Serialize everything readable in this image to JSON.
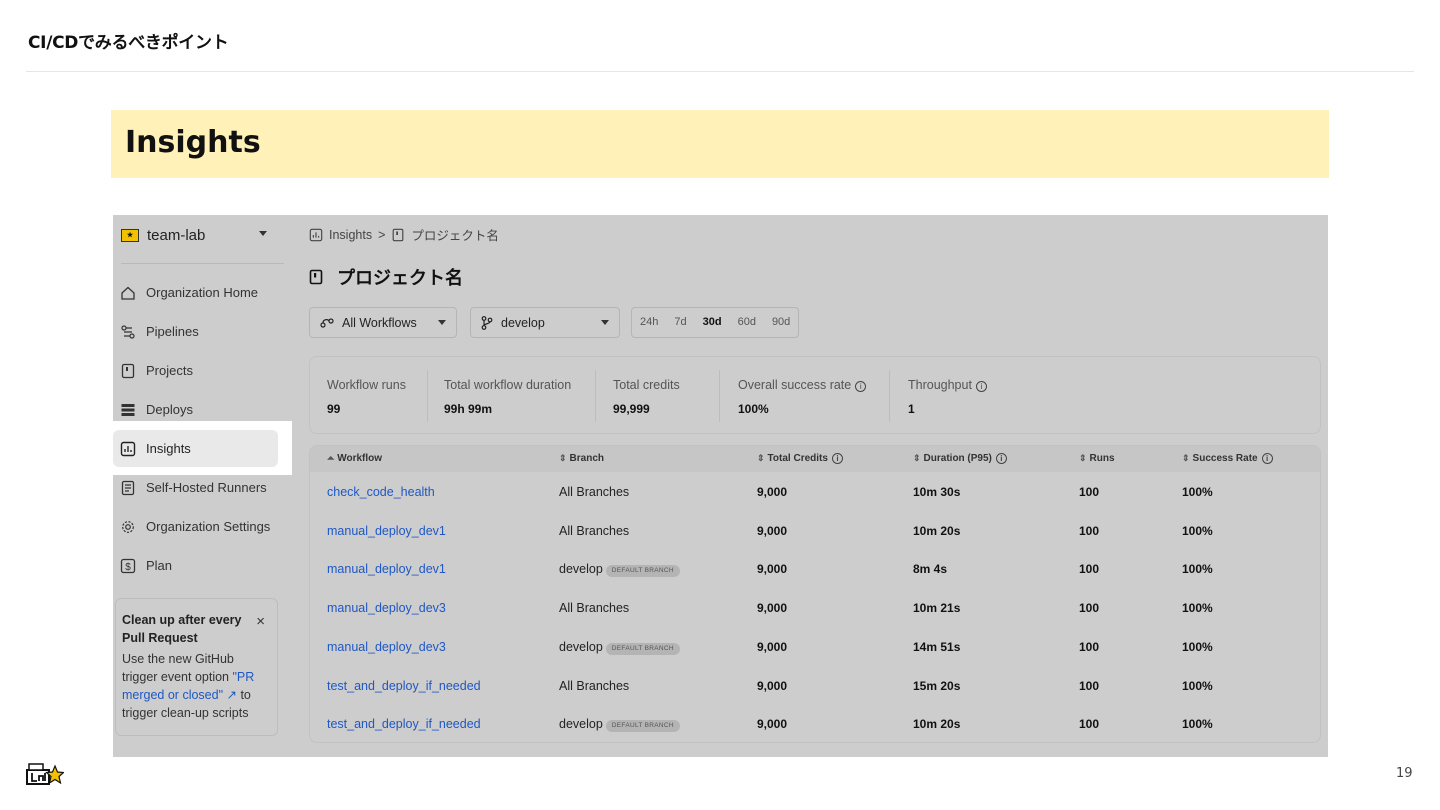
{
  "slide": {
    "header": "CI/CDでみるべきポイント",
    "banner_title": "Insights",
    "page_number": "19"
  },
  "sidebar": {
    "org_name": "team-lab",
    "items": [
      {
        "label": "Organization Home",
        "icon": "home-icon"
      },
      {
        "label": "Pipelines",
        "icon": "pipelines-icon"
      },
      {
        "label": "Projects",
        "icon": "project-icon"
      },
      {
        "label": "Deploys",
        "icon": "deploys-icon"
      },
      {
        "label": "Insights",
        "icon": "insights-icon",
        "active": true
      },
      {
        "label": "Self-Hosted Runners",
        "icon": "runner-icon"
      },
      {
        "label": "Organization Settings",
        "icon": "gear-icon"
      },
      {
        "label": "Plan",
        "icon": "dollar-icon"
      }
    ],
    "promo": {
      "title": "Clean up after every Pull Request",
      "close": "×",
      "body_pre": "Use the new GitHub trigger event option ",
      "link": "\"PR merged or closed\" ↗",
      "body_post": " to trigger clean-up scripts"
    }
  },
  "breadcrumb": {
    "root": "Insights",
    "sep": ">",
    "project": "プロジェクト名"
  },
  "page_title": "プロジェクト名",
  "filters": {
    "workflow": "All Workflows",
    "branch": "develop",
    "ranges": [
      "24h",
      "7d",
      "30d",
      "60d",
      "90d"
    ],
    "selected_range": "30d"
  },
  "stats": [
    {
      "label": "Workflow runs",
      "value": "99",
      "info": false
    },
    {
      "label": "Total workflow duration",
      "value": "99h 99m",
      "info": false
    },
    {
      "label": "Total credits",
      "value": "99,999",
      "info": false
    },
    {
      "label": "Overall success rate",
      "value": "100%",
      "info": true
    },
    {
      "label": "Throughput",
      "value": "1",
      "info": true
    }
  ],
  "table": {
    "columns": [
      "Workflow",
      "Branch",
      "Total Credits",
      "Duration (P95)",
      "Runs",
      "Success Rate"
    ],
    "default_branch_badge": "DEFAULT BRANCH",
    "rows": [
      {
        "workflow": "check_code_health",
        "branch": "All Branches",
        "default": false,
        "credits": "9,000",
        "duration": "10m 30s",
        "runs": "100",
        "rate": "100%"
      },
      {
        "workflow": "manual_deploy_dev1",
        "branch": "All Branches",
        "default": false,
        "credits": "9,000",
        "duration": "10m 20s",
        "runs": "100",
        "rate": "100%"
      },
      {
        "workflow": "manual_deploy_dev1",
        "branch": "develop",
        "default": true,
        "credits": "9,000",
        "duration": "8m 4s",
        "runs": "100",
        "rate": "100%"
      },
      {
        "workflow": "manual_deploy_dev3",
        "branch": "All Branches",
        "default": false,
        "credits": "9,000",
        "duration": "10m 21s",
        "runs": "100",
        "rate": "100%"
      },
      {
        "workflow": "manual_deploy_dev3",
        "branch": "develop",
        "default": true,
        "credits": "9,000",
        "duration": "14m 51s",
        "runs": "100",
        "rate": "100%"
      },
      {
        "workflow": "test_and_deploy_if_needed",
        "branch": "All Branches",
        "default": false,
        "credits": "9,000",
        "duration": "15m 20s",
        "runs": "100",
        "rate": "100%"
      },
      {
        "workflow": "test_and_deploy_if_needed",
        "branch": "develop",
        "default": true,
        "credits": "9,000",
        "duration": "10m 20s",
        "runs": "100",
        "rate": "100%"
      }
    ]
  },
  "footer_logo": {
    "text": "team Lab",
    "accent": "#f2c200"
  }
}
